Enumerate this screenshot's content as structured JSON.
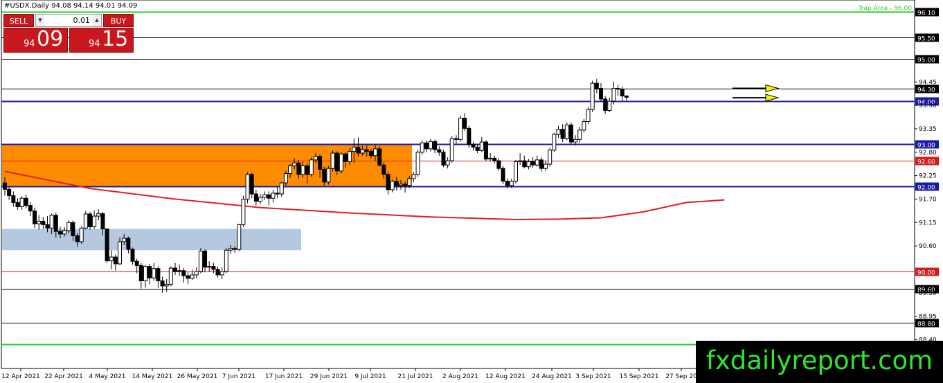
{
  "header": {
    "title": "#USDX,Daily  94.08 94.14 94.01 94.09"
  },
  "trade_panel": {
    "sell_label": "SELL",
    "buy_label": "BUY",
    "lot_value": "0.01",
    "sell_price_prefix": "94",
    "sell_price_big": "09",
    "buy_price_prefix": "94",
    "buy_price_big": "15"
  },
  "watermark": "fxdailyreport.com",
  "colors": {
    "candle_up": "#ffffff",
    "candle_down": "#000000",
    "moving_average": "#e0201e",
    "blue_level": "#1a1aa8",
    "red_level": "#d81a1a",
    "green_level": "#1fd11f",
    "orange_zone": "#ff8c00",
    "blue_zone": "#b4c8e0",
    "arrow_fill": "#f5f100"
  },
  "chart_data": {
    "type": "candlestick",
    "ylim": [
      89.3,
      96.2
    ],
    "y_ticks": [
      "94.45",
      "93.90",
      "93.35",
      "92.80",
      "92.25",
      "91.70",
      "91.15",
      "90.60",
      "89.50",
      "88.95",
      "88.40"
    ],
    "x_tick_labels": [
      "12 Apr 2021",
      "22 Apr 2021",
      "4 May 2021",
      "14 May 2021",
      "26 May 2021",
      "7 Jun 2021",
      "17 Jun 2021",
      "29 Jun 2021",
      "9 Jul 2021",
      "21 Jul 2021",
      "2 Aug 2021",
      "12 Aug 2021",
      "24 Aug 2021",
      "3 Sep 2021",
      "15 Sep 2021",
      "27 Sep 20"
    ],
    "levels": [
      {
        "value": 96.1,
        "label": "96.10",
        "color": "green",
        "note": "Trap Area - 96.00"
      },
      {
        "value": 95.5,
        "label": "95.50",
        "color": "black"
      },
      {
        "value": 95.0,
        "label": "95.00",
        "color": "black"
      },
      {
        "value": 94.3,
        "label": "94.30",
        "color": "black"
      },
      {
        "value": 94.0,
        "label": "94.00",
        "color": "blue"
      },
      {
        "value": 93.0,
        "label": "93.00",
        "color": "blue"
      },
      {
        "value": 92.6,
        "label": "92.60",
        "color": "red"
      },
      {
        "value": 92.0,
        "label": "92.00",
        "color": "blue"
      },
      {
        "value": 90.0,
        "label": "90.00",
        "color": "red"
      },
      {
        "value": 89.6,
        "label": "89.60",
        "color": "black"
      },
      {
        "value": 88.8,
        "label": "88.80",
        "color": "black"
      },
      {
        "value": 88.3,
        "label": "",
        "color": "green"
      }
    ],
    "zones": [
      {
        "from": 92.0,
        "to": 93.0,
        "start_index": 0,
        "end_index": 97,
        "color": "orange"
      },
      {
        "from": 90.5,
        "to": 91.0,
        "start_index": 0,
        "end_index": 71,
        "color": "blue"
      }
    ],
    "moving_average": [
      [
        0,
        92.35
      ],
      [
        20,
        91.95
      ],
      [
        40,
        91.7
      ],
      [
        60,
        91.5
      ],
      [
        80,
        91.38
      ],
      [
        100,
        91.28
      ],
      [
        120,
        91.22
      ],
      [
        130,
        91.23
      ],
      [
        140,
        91.26
      ],
      [
        150,
        91.4
      ],
      [
        160,
        91.62
      ],
      [
        169,
        91.68
      ]
    ],
    "candles": [
      [
        92.08,
        91.93,
        92.22,
        91.78
      ],
      [
        91.93,
        91.78,
        91.98,
        91.68
      ],
      [
        91.78,
        91.62,
        91.88,
        91.52
      ],
      [
        91.62,
        91.52,
        91.72,
        91.45
      ],
      [
        91.52,
        91.72,
        91.77,
        91.45
      ],
      [
        91.72,
        91.55,
        91.8,
        91.48
      ],
      [
        91.55,
        91.42,
        91.63,
        91.3
      ],
      [
        91.42,
        91.12,
        91.5,
        91.02
      ],
      [
        91.12,
        91.18,
        91.32,
        90.98
      ],
      [
        91.18,
        91.1,
        91.28,
        91.0
      ],
      [
        91.1,
        91.02,
        91.3,
        90.92
      ],
      [
        91.02,
        91.32,
        91.36,
        90.88
      ],
      [
        91.32,
        90.94,
        91.38,
        90.8
      ],
      [
        90.94,
        90.88,
        91.05,
        90.78
      ],
      [
        90.88,
        90.96,
        91.04,
        90.82
      ],
      [
        90.96,
        91.15,
        91.2,
        90.9
      ],
      [
        91.15,
        90.84,
        91.2,
        90.72
      ],
      [
        90.84,
        90.7,
        90.9,
        90.58
      ],
      [
        90.7,
        91.02,
        91.06,
        90.65
      ],
      [
        91.02,
        91.35,
        91.42,
        90.98
      ],
      [
        91.35,
        91.05,
        91.4,
        90.98
      ],
      [
        91.05,
        91.3,
        91.43,
        91.0
      ],
      [
        91.3,
        91.36,
        91.46,
        91.2
      ],
      [
        91.36,
        91.0,
        91.4,
        90.85
      ],
      [
        91.0,
        90.25,
        91.0,
        90.2
      ],
      [
        90.25,
        90.34,
        90.5,
        90.05
      ],
      [
        90.34,
        90.18,
        90.4,
        90.02
      ],
      [
        90.18,
        90.7,
        90.8,
        90.15
      ],
      [
        90.7,
        90.78,
        90.88,
        90.62
      ],
      [
        90.78,
        90.52,
        90.82,
        90.42
      ],
      [
        90.52,
        90.24,
        90.56,
        90.16
      ],
      [
        90.24,
        90.14,
        90.3,
        89.96
      ],
      [
        90.14,
        89.78,
        90.2,
        89.6
      ],
      [
        89.78,
        90.12,
        90.16,
        89.62
      ],
      [
        90.12,
        89.85,
        90.18,
        89.7
      ],
      [
        89.85,
        90.07,
        90.2,
        89.78
      ],
      [
        90.07,
        89.78,
        90.12,
        89.62
      ],
      [
        89.78,
        89.66,
        89.88,
        89.5
      ],
      [
        89.66,
        89.7,
        89.82,
        89.52
      ],
      [
        89.7,
        90.08,
        90.12,
        89.65
      ],
      [
        90.08,
        90.0,
        90.2,
        89.92
      ],
      [
        90.0,
        90.02,
        90.16,
        89.9
      ],
      [
        90.02,
        89.9,
        90.08,
        89.74
      ],
      [
        89.9,
        89.84,
        89.98,
        89.7
      ],
      [
        89.84,
        89.92,
        90.04,
        89.8
      ],
      [
        89.92,
        90.0,
        90.1,
        89.84
      ],
      [
        90.0,
        90.48,
        90.55,
        89.96
      ],
      [
        90.48,
        90.1,
        90.52,
        89.98
      ],
      [
        90.1,
        90.12,
        90.24,
        90.0
      ],
      [
        90.12,
        90.05,
        90.2,
        89.96
      ],
      [
        90.05,
        89.92,
        90.12,
        89.86
      ],
      [
        89.92,
        90.0,
        90.1,
        89.82
      ],
      [
        90.0,
        90.5,
        90.55,
        89.96
      ],
      [
        90.5,
        90.54,
        90.62,
        90.42
      ],
      [
        90.54,
        90.52,
        90.6,
        90.44
      ],
      [
        90.52,
        91.1,
        91.12,
        90.48
      ],
      [
        91.1,
        91.7,
        91.78,
        91.05
      ],
      [
        91.7,
        92.28,
        92.33,
        91.6
      ],
      [
        92.28,
        91.82,
        92.32,
        91.72
      ],
      [
        91.82,
        91.65,
        91.92,
        91.55
      ],
      [
        91.65,
        91.74,
        91.82,
        91.58
      ],
      [
        91.74,
        91.8,
        91.88,
        91.68
      ],
      [
        91.8,
        91.72,
        91.88,
        91.55
      ],
      [
        91.72,
        91.84,
        91.92,
        91.62
      ],
      [
        91.84,
        91.82,
        91.98,
        91.72
      ],
      [
        91.82,
        92.08,
        92.1,
        91.75
      ],
      [
        92.08,
        92.3,
        92.36,
        92.02
      ],
      [
        92.3,
        92.48,
        92.52,
        92.2
      ],
      [
        92.48,
        92.55,
        92.66,
        92.4
      ],
      [
        92.55,
        92.28,
        92.62,
        92.18
      ],
      [
        92.28,
        92.48,
        92.58,
        92.2
      ],
      [
        92.48,
        92.28,
        92.54,
        92.06
      ],
      [
        92.28,
        92.62,
        92.68,
        92.22
      ],
      [
        92.62,
        92.7,
        92.78,
        92.55
      ],
      [
        92.7,
        92.4,
        92.75,
        92.2
      ],
      [
        92.4,
        92.1,
        92.46,
        92.02
      ],
      [
        92.1,
        92.42,
        92.48,
        92.04
      ],
      [
        92.42,
        92.78,
        92.84,
        92.35
      ],
      [
        92.78,
        92.36,
        92.82,
        92.26
      ],
      [
        92.36,
        92.76,
        92.8,
        92.3
      ],
      [
        92.76,
        92.58,
        92.8,
        92.44
      ],
      [
        92.58,
        92.82,
        92.9,
        92.5
      ],
      [
        92.82,
        92.92,
        93.12,
        92.55
      ],
      [
        92.92,
        92.78,
        93.15,
        92.7
      ],
      [
        92.78,
        92.86,
        92.95,
        92.72
      ],
      [
        92.86,
        92.82,
        92.96,
        92.7
      ],
      [
        92.82,
        92.72,
        92.88,
        92.65
      ],
      [
        92.72,
        92.88,
        92.98,
        92.6
      ],
      [
        92.88,
        92.5,
        92.94,
        92.46
      ],
      [
        92.5,
        92.28,
        92.56,
        92.18
      ],
      [
        92.28,
        91.92,
        92.34,
        91.8
      ],
      [
        91.92,
        92.12,
        92.16,
        91.86
      ],
      [
        92.12,
        92.02,
        92.22,
        91.9
      ],
      [
        92.02,
        92.05,
        92.15,
        91.92
      ],
      [
        92.05,
        92.02,
        92.12,
        91.85
      ],
      [
        92.02,
        92.18,
        92.24,
        91.96
      ],
      [
        92.18,
        92.28,
        92.34,
        92.1
      ],
      [
        92.28,
        92.8,
        92.86,
        92.22
      ],
      [
        92.8,
        93.02,
        93.08,
        92.74
      ],
      [
        93.02,
        92.88,
        93.08,
        92.8
      ],
      [
        92.88,
        93.05,
        93.12,
        92.82
      ],
      [
        93.05,
        92.86,
        93.1,
        92.78
      ],
      [
        92.86,
        92.8,
        92.94,
        92.72
      ],
      [
        92.8,
        92.5,
        92.86,
        92.45
      ],
      [
        92.5,
        92.6,
        92.68,
        92.42
      ],
      [
        92.6,
        93.12,
        93.18,
        92.55
      ],
      [
        93.12,
        93.1,
        93.2,
        93.0
      ],
      [
        93.1,
        93.6,
        93.66,
        93.05
      ],
      [
        93.6,
        93.36,
        93.72,
        93.3
      ],
      [
        93.36,
        92.98,
        93.42,
        92.9
      ],
      [
        92.98,
        92.92,
        93.05,
        92.84
      ],
      [
        92.92,
        92.84,
        93.0,
        92.78
      ],
      [
        92.84,
        93.04,
        93.16,
        92.8
      ],
      [
        93.04,
        92.64,
        93.08,
        92.6
      ],
      [
        92.64,
        92.66,
        92.78,
        92.58
      ],
      [
        92.66,
        92.6,
        92.72,
        92.54
      ],
      [
        92.6,
        92.42,
        92.66,
        92.36
      ],
      [
        92.42,
        92.12,
        92.48,
        92.05
      ],
      [
        92.12,
        92.02,
        92.18,
        91.95
      ],
      [
        92.02,
        92.12,
        92.18,
        91.96
      ],
      [
        92.12,
        92.58,
        92.62,
        92.06
      ],
      [
        92.58,
        92.6,
        92.78,
        92.5
      ],
      [
        92.6,
        92.46,
        92.72,
        92.42
      ],
      [
        92.46,
        92.58,
        92.64,
        92.4
      ],
      [
        92.58,
        92.5,
        92.68,
        92.44
      ],
      [
        92.5,
        92.62,
        92.72,
        92.46
      ],
      [
        92.62,
        92.42,
        92.68,
        92.35
      ],
      [
        92.42,
        92.52,
        92.6,
        92.36
      ],
      [
        92.52,
        92.85,
        92.9,
        92.46
      ],
      [
        92.85,
        93.22,
        93.26,
        92.8
      ],
      [
        93.22,
        93.34,
        93.42,
        93.14
      ],
      [
        93.34,
        93.12,
        93.46,
        93.04
      ],
      [
        93.12,
        93.44,
        93.5,
        93.08
      ],
      [
        93.44,
        93.04,
        93.5,
        92.98
      ],
      [
        93.04,
        93.1,
        93.2,
        92.96
      ],
      [
        93.1,
        93.32,
        93.4,
        93.02
      ],
      [
        93.32,
        93.52,
        93.58,
        93.26
      ],
      [
        93.52,
        93.8,
        93.86,
        93.46
      ],
      [
        93.8,
        94.42,
        94.48,
        93.74
      ],
      [
        94.42,
        94.3,
        94.52,
        94.18
      ],
      [
        94.3,
        94.05,
        94.42,
        93.98
      ],
      [
        94.05,
        93.78,
        94.12,
        93.7
      ],
      [
        93.78,
        94.0,
        94.08,
        93.74
      ],
      [
        94.0,
        94.3,
        94.46,
        93.92
      ],
      [
        94.3,
        94.28,
        94.38,
        94.12
      ],
      [
        94.28,
        94.12,
        94.34,
        94.0
      ],
      [
        94.12,
        94.09,
        94.14,
        94.01
      ]
    ],
    "arrows": [
      {
        "y": 94.3,
        "direction": "right"
      },
      {
        "y": 94.08,
        "direction": "right"
      }
    ]
  }
}
